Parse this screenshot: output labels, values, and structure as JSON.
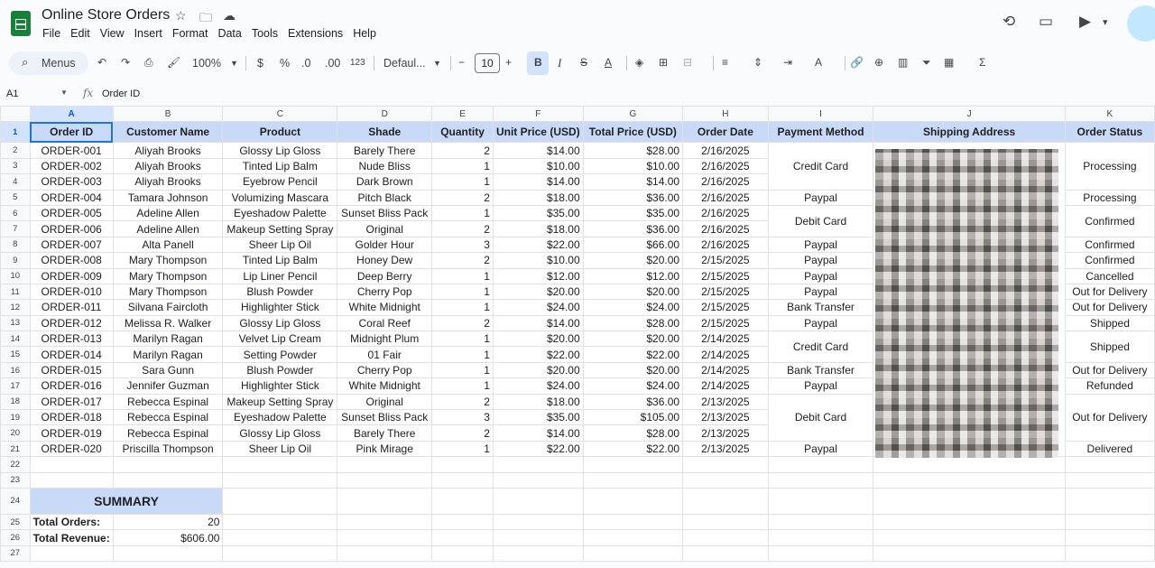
{
  "app": {
    "title": "Online Store Orders",
    "menus": [
      "File",
      "Edit",
      "View",
      "Insert",
      "Format",
      "Data",
      "Tools",
      "Extensions",
      "Help"
    ]
  },
  "toolbar": {
    "search_label": "Menus",
    "zoom": "100%",
    "currency": "$",
    "percent": "%",
    "dec_decrease": ".0",
    "dec_increase": ".00",
    "number_format": "123",
    "font": "Defaul...",
    "font_size": "10"
  },
  "formula_bar": {
    "cell": "A1",
    "value": "Order ID"
  },
  "columns": [
    "A",
    "B",
    "C",
    "D",
    "E",
    "F",
    "G",
    "H",
    "I",
    "J",
    "K"
  ],
  "headers": [
    "Order ID",
    "Customer Name",
    "Product",
    "Shade",
    "Quantity",
    "Unit Price (USD)",
    "Total Price (USD)",
    "Order Date",
    "Payment Method",
    "Shipping Address",
    "Order Status"
  ],
  "orders": [
    [
      "ORDER-001",
      "Aliyah Brooks",
      "Glossy Lip Gloss",
      "Barely There",
      "2",
      "$14.00",
      "$28.00",
      "2/16/2025"
    ],
    [
      "ORDER-002",
      "Aliyah Brooks",
      "Tinted Lip Balm",
      "Nude Bliss",
      "1",
      "$10.00",
      "$10.00",
      "2/16/2025"
    ],
    [
      "ORDER-003",
      "Aliyah Brooks",
      "Eyebrow Pencil",
      "Dark Brown",
      "1",
      "$14.00",
      "$14.00",
      "2/16/2025"
    ],
    [
      "ORDER-004",
      "Tamara Johnson",
      "Volumizing Mascara",
      "Pitch Black",
      "2",
      "$18.00",
      "$36.00",
      "2/16/2025"
    ],
    [
      "ORDER-005",
      "Adeline Allen",
      "Eyeshadow Palette",
      "Sunset Bliss Pack",
      "1",
      "$35.00",
      "$35.00",
      "2/16/2025"
    ],
    [
      "ORDER-006",
      "Adeline Allen",
      "Makeup Setting Spray",
      "Original",
      "2",
      "$18.00",
      "$36.00",
      "2/16/2025"
    ],
    [
      "ORDER-007",
      "Alta Panell",
      "Sheer Lip Oil",
      "Golder Hour",
      "3",
      "$22.00",
      "$66.00",
      "2/16/2025"
    ],
    [
      "ORDER-008",
      "Mary Thompson",
      "Tinted Lip Balm",
      "Honey Dew",
      "2",
      "$10.00",
      "$20.00",
      "2/15/2025"
    ],
    [
      "ORDER-009",
      "Mary Thompson",
      "Lip Liner Pencil",
      "Deep Berry",
      "1",
      "$12.00",
      "$12.00",
      "2/15/2025"
    ],
    [
      "ORDER-010",
      "Mary Thompson",
      "Blush Powder",
      "Cherry Pop",
      "1",
      "$20.00",
      "$20.00",
      "2/15/2025"
    ],
    [
      "ORDER-011",
      "Silvana Faircloth",
      "Highlighter Stick",
      "White Midnight",
      "1",
      "$24.00",
      "$24.00",
      "2/15/2025"
    ],
    [
      "ORDER-012",
      "Melissa R. Walker",
      "Glossy Lip Gloss",
      "Coral Reef",
      "2",
      "$14.00",
      "$28.00",
      "2/15/2025"
    ],
    [
      "ORDER-013",
      "Marilyn Ragan",
      "Velvet Lip Cream",
      "Midnight Plum",
      "1",
      "$20.00",
      "$20.00",
      "2/14/2025"
    ],
    [
      "ORDER-014",
      "Marilyn Ragan",
      "Setting Powder",
      "01 Fair",
      "1",
      "$22.00",
      "$22.00",
      "2/14/2025"
    ],
    [
      "ORDER-015",
      "Sara Gunn",
      "Blush Powder",
      "Cherry Pop",
      "1",
      "$20.00",
      "$20.00",
      "2/14/2025"
    ],
    [
      "ORDER-016",
      "Jennifer Guzman",
      "Highlighter Stick",
      "White Midnight",
      "1",
      "$24.00",
      "$24.00",
      "2/14/2025"
    ],
    [
      "ORDER-017",
      "Rebecca Espinal",
      "Makeup Setting Spray",
      "Original",
      "2",
      "$18.00",
      "$36.00",
      "2/13/2025"
    ],
    [
      "ORDER-018",
      "Rebecca Espinal",
      "Eyeshadow Palette",
      "Sunset Bliss Pack",
      "3",
      "$35.00",
      "$105.00",
      "2/13/2025"
    ],
    [
      "ORDER-019",
      "Rebecca Espinal",
      "Glossy Lip Gloss",
      "Barely There",
      "2",
      "$14.00",
      "$28.00",
      "2/13/2025"
    ],
    [
      "ORDER-020",
      "Priscilla Thompson",
      "Sheer Lip Oil",
      "Pink Mirage",
      "1",
      "$22.00",
      "$22.00",
      "2/13/2025"
    ]
  ],
  "payment_blocks": [
    {
      "text": "Credit Card",
      "span": 3
    },
    {
      "text": "Paypal",
      "span": 1
    },
    {
      "text": "Debit Card",
      "span": 2
    },
    {
      "text": "Paypal",
      "span": 1
    },
    {
      "text": "Paypal",
      "span": 1
    },
    {
      "text": "Paypal",
      "span": 1
    },
    {
      "text": "Paypal",
      "span": 1
    },
    {
      "text": "Bank Transfer",
      "span": 1
    },
    {
      "text": "Paypal",
      "span": 1
    },
    {
      "text": "Credit Card",
      "span": 2
    },
    {
      "text": "Bank Transfer",
      "span": 1
    },
    {
      "text": "Paypal",
      "span": 1
    },
    {
      "text": "Debit Card",
      "span": 3
    },
    {
      "text": "Paypal",
      "span": 1
    }
  ],
  "status_blocks": [
    {
      "text": "Processing",
      "span": 3
    },
    {
      "text": "Processing",
      "span": 1
    },
    {
      "text": "Confirmed",
      "span": 2
    },
    {
      "text": "Confirmed",
      "span": 1
    },
    {
      "text": "Confirmed",
      "span": 1
    },
    {
      "text": "Cancelled",
      "span": 1
    },
    {
      "text": "Out for Delivery",
      "span": 1
    },
    {
      "text": "Out for Delivery",
      "span": 1
    },
    {
      "text": "Shipped",
      "span": 1
    },
    {
      "text": "Shipped",
      "span": 2
    },
    {
      "text": "Out for Delivery",
      "span": 1
    },
    {
      "text": "Refunded",
      "span": 1
    },
    {
      "text": "Out for Delivery",
      "span": 3
    },
    {
      "text": "Delivered",
      "span": 1
    }
  ],
  "summary": {
    "title": "SUMMARY",
    "total_orders_label": "Total Orders:",
    "total_orders": "20",
    "total_revenue_label": "Total Revenue:",
    "total_revenue": "$606.00"
  },
  "colors": {
    "header_fill": "#c9daf8",
    "selection": "#1a73e8",
    "sheets_green": "#188038"
  }
}
